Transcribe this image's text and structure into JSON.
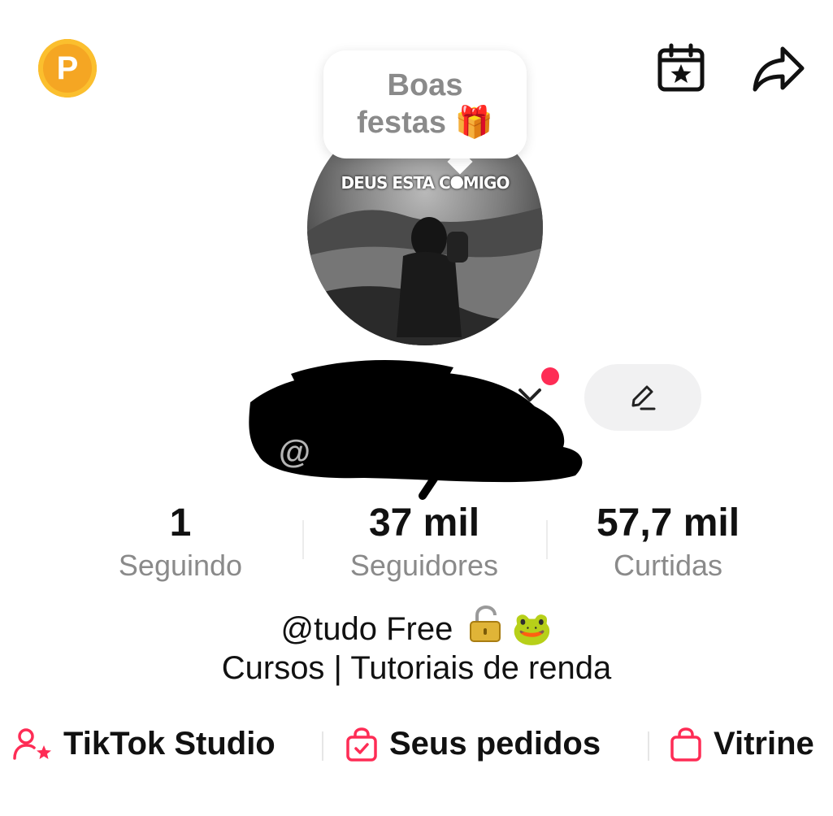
{
  "header": {
    "coin_label": "P",
    "calendar_icon": "calendar-star-icon",
    "share_icon": "share-arrow-icon"
  },
  "bubble": {
    "line1": "Boas",
    "line2": "festas 🎁"
  },
  "avatar": {
    "caption": "DEUS ESTA COMIGO"
  },
  "profile": {
    "handle_prefix": "@",
    "notification_color": "#fe2c55",
    "edit_icon": "pencil-icon"
  },
  "stats": {
    "following": {
      "value": "1",
      "label": "Seguindo"
    },
    "followers": {
      "value": "37 mil",
      "label": "Seguidores"
    },
    "likes": {
      "value": "57,7 mil",
      "label": "Curtidas"
    }
  },
  "bio": {
    "line1": "@tudo Free",
    "line1_emoji": "🐸",
    "line2": "Cursos | Tutoriais de renda"
  },
  "shortcuts": {
    "studio": "TikTok Studio",
    "orders": "Seus pedidos",
    "vitrine": "Vitrine"
  },
  "colors": {
    "accent": "#fe2c55",
    "muted_text": "#8a8a8a",
    "coin": "#f5a623"
  }
}
